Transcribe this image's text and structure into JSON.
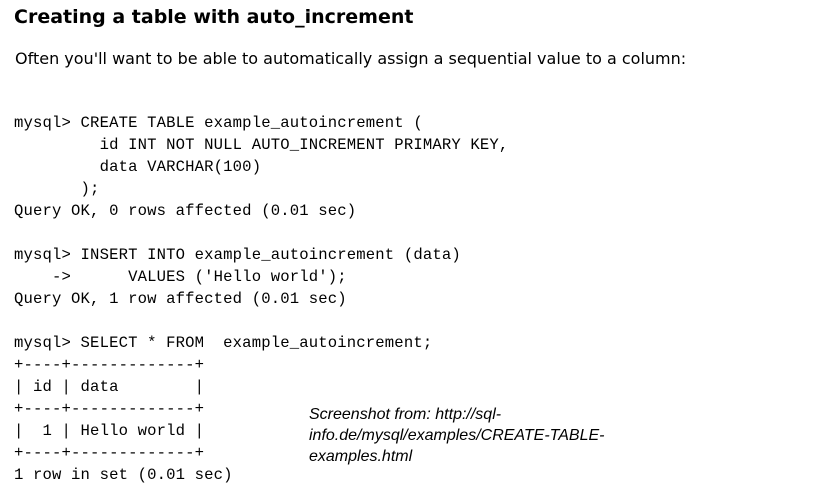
{
  "heading": "Creating a table with auto_increment",
  "intro": "Often you'll want to be able to automatically assign a sequential value to a column:",
  "code_lines": [
    "mysql> CREATE TABLE example_autoincrement (",
    "         id INT NOT NULL AUTO_INCREMENT PRIMARY KEY,",
    "         data VARCHAR(100)",
    "       );",
    "Query OK, 0 rows affected (0.01 sec)",
    "",
    "mysql> INSERT INTO example_autoincrement (data)",
    "    ->      VALUES ('Hello world');",
    "Query OK, 1 row affected (0.01 sec)",
    "",
    "mysql> SELECT * FROM  example_autoincrement;",
    "+----+-------------+",
    "| id | data        |",
    "+----+-------------+",
    "|  1 | Hello world |",
    "+----+-------------+",
    "1 row in set (0.01 sec)"
  ],
  "caption": {
    "line1": "Screenshot from: http://sql-",
    "line2": "info.de/mysql/examples/CREATE-TABLE-",
    "line3": "examples.html"
  }
}
